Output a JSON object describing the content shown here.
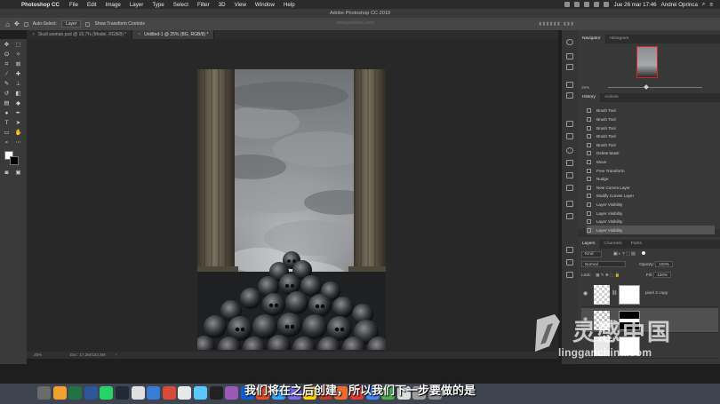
{
  "menubar": {
    "app_name": "Photoshop CC",
    "items": [
      "File",
      "Edit",
      "Image",
      "Layer",
      "Type",
      "Select",
      "Filter",
      "3D",
      "View",
      "Window",
      "Help"
    ],
    "clock": "Jue 26 mar  17:46",
    "user": "Andrei Oprinca"
  },
  "window": {
    "title": "Adobe Photoshop CC 2019"
  },
  "options": {
    "auto_select_label": "Auto-Select:",
    "auto_select_value": "Layer",
    "transform_controls_label": "Show Transform Controls",
    "watermark": "www.psdbox.com"
  },
  "tabs": [
    {
      "label": "Skull woman.psd @ 16,7% (Model, RGB/8) *"
    },
    {
      "label": "Untitled-1 @ 25% (BG, RGB/8) *"
    }
  ],
  "status": {
    "zoom": "25%",
    "doc_size": "Doc: 17,2M/102,8M"
  },
  "navigator": {
    "tabs": [
      "Navigator",
      "Histogram"
    ],
    "zoom": "25%"
  },
  "history": {
    "tabs": [
      "History",
      "Actions"
    ],
    "items": [
      "Brush Tool",
      "Brush Tool",
      "Brush Tool",
      "Brush Tool",
      "Brush Tool",
      "Delete Mask",
      "Move",
      "Free Transform",
      "Nudge",
      "New Curves Layer",
      "Modify Curves Layer",
      "Layer Visibility",
      "Layer Visibility",
      "Layer Visibility",
      "Layer Visibility"
    ]
  },
  "layers": {
    "tabs": [
      "Layers",
      "Channels",
      "Paths"
    ],
    "kind": "Kind",
    "blend_mode": "Normal",
    "opacity_label": "Opacity:",
    "opacity": "100%",
    "lock_label": "Lock:",
    "fill_label": "Fill:",
    "fill": "100%",
    "rows": [
      {
        "name": "pixel 2 copy"
      },
      {
        "name": ""
      }
    ]
  },
  "subtitle": "我们将在之后创建，所以我们下一步要做的是",
  "site": {
    "logo_text": "灵感中国",
    "url": "lingganchina.com"
  },
  "colors": {
    "accent": "#1473e6",
    "panel": "#383838",
    "canvas": "#282828"
  }
}
